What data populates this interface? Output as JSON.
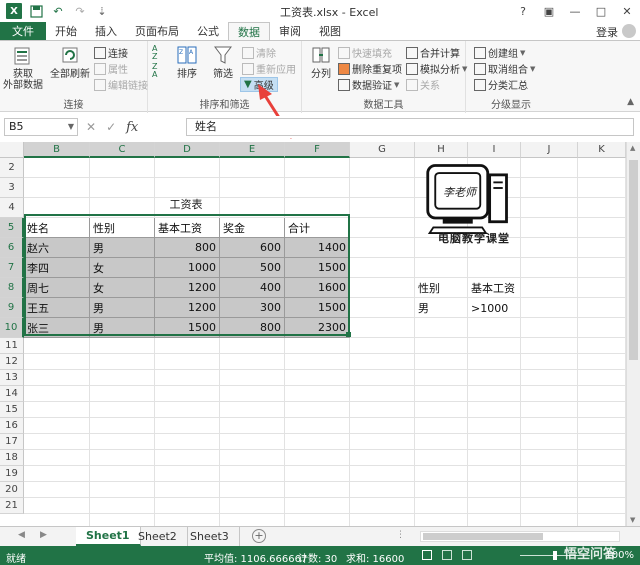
{
  "window": {
    "title": "工资表.xlsx - Excel",
    "login": "登录"
  },
  "tabs": [
    "文件",
    "开始",
    "插入",
    "页面布局",
    "公式",
    "数据",
    "审阅",
    "视图"
  ],
  "active_tab_index": 5,
  "ribbon": {
    "get_external": "获取\n外部数据",
    "refresh_all": "全部刷新",
    "connections": "连接",
    "properties": "属性",
    "edit_links": "编辑链接",
    "group_connections": "连接",
    "sort": "排序",
    "filter": "筛选",
    "clear": "清除",
    "reapply": "重新应用",
    "advanced": "高级",
    "group_sort_filter": "排序和筛选",
    "text_to_columns": "分列",
    "flash_fill": "快速填充",
    "remove_duplicates": "删除重复项",
    "data_validation": "数据验证",
    "consolidate": "合并计算",
    "what_if": "模拟分析",
    "relationships": "关系",
    "group_data_tools": "数据工具",
    "group": "创建组",
    "ungroup": "取消组合",
    "subtotal": "分类汇总",
    "group_outline": "分级显示",
    "colors": {
      "accent": "#217346",
      "highlight": "#c5dff3",
      "arrow": "#e8403a"
    }
  },
  "formula_bar": {
    "name_box": "B5",
    "fx": "fx",
    "content": "姓名"
  },
  "columns": [
    "B",
    "C",
    "D",
    "E",
    "F",
    "G",
    "H",
    "I",
    "J",
    "K"
  ],
  "rows": [
    "2",
    "3",
    "4",
    "5",
    "6",
    "7",
    "8",
    "9",
    "10",
    "11",
    "12",
    "13",
    "14",
    "15",
    "16",
    "17",
    "18",
    "19",
    "20",
    "21"
  ],
  "sheet": {
    "table_title": "工资表",
    "headers": [
      "姓名",
      "性别",
      "基本工资",
      "奖金",
      "合计"
    ],
    "rows": [
      [
        "赵六",
        "男",
        "800",
        "600",
        "1400"
      ],
      [
        "李四",
        "女",
        "1000",
        "500",
        "1500"
      ],
      [
        "周七",
        "女",
        "1200",
        "400",
        "1600"
      ],
      [
        "王五",
        "男",
        "1200",
        "300",
        "1500"
      ],
      [
        "张三",
        "男",
        "1500",
        "800",
        "2300"
      ]
    ],
    "criteria": {
      "h8": "性别",
      "i8": "基本工资",
      "h9": "男",
      "i9": ">1000"
    },
    "logo_text": "李老师",
    "logo_caption": "电脑教学课堂"
  },
  "sheet_tabs": [
    "Sheet1",
    "Sheet2",
    "Sheet3"
  ],
  "active_sheet": 0,
  "status": {
    "ready": "就绪",
    "average": "平均值: 1106.666667",
    "count": "计数: 30",
    "sum": "求和: 16600",
    "zoom": "100%",
    "watermark": "悟空问答"
  }
}
